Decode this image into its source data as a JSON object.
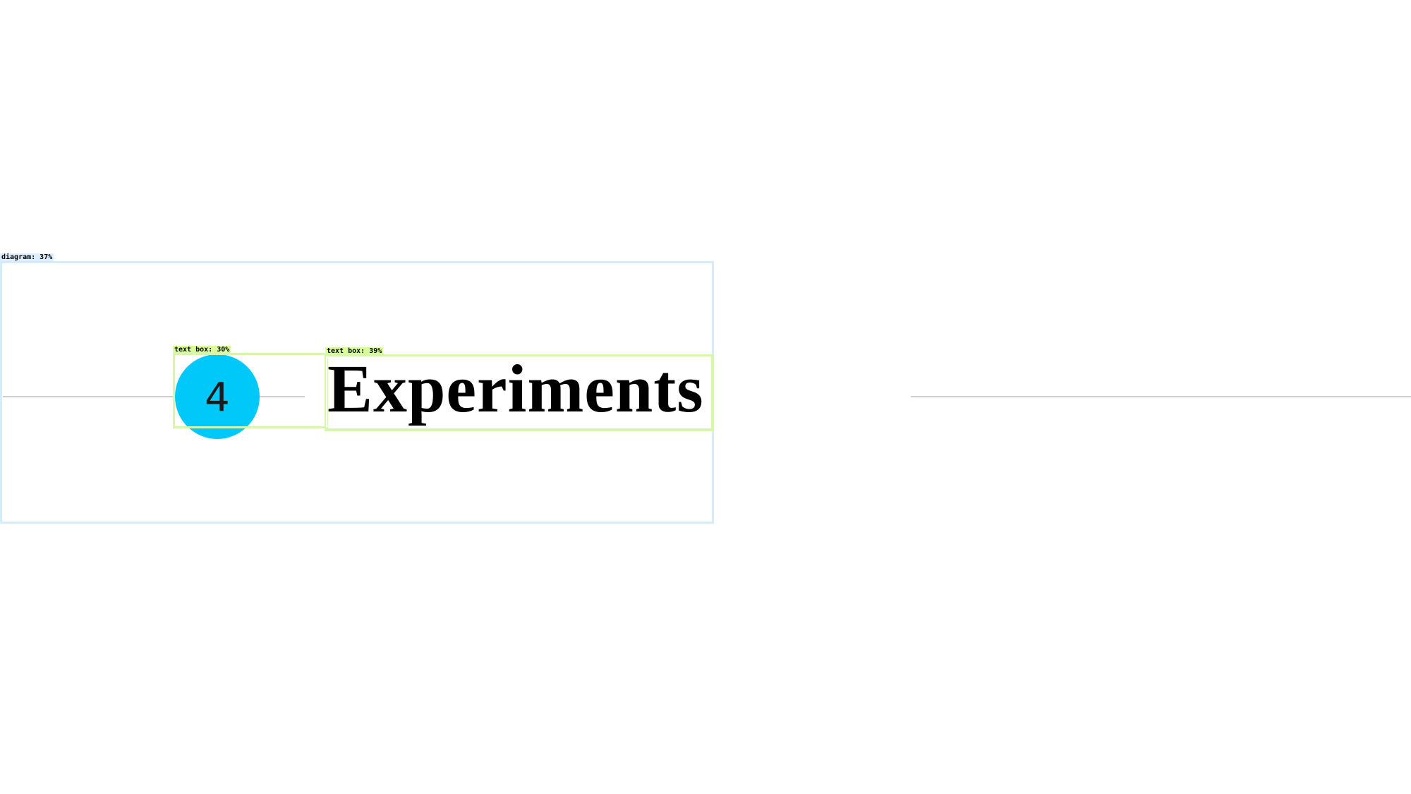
{
  "detections": {
    "diagram_label": "diagram: 37%",
    "textbox_number_label": "text box: 30%",
    "textbox_title_label": "text box: 39%"
  },
  "section": {
    "number": "4",
    "title": "Experiments"
  },
  "colors": {
    "accent_circle": "#00c8f8",
    "divider": "#cfcfcf",
    "diagram_box": "#d6ecf8",
    "textbox_box": "#d6f7ad"
  }
}
